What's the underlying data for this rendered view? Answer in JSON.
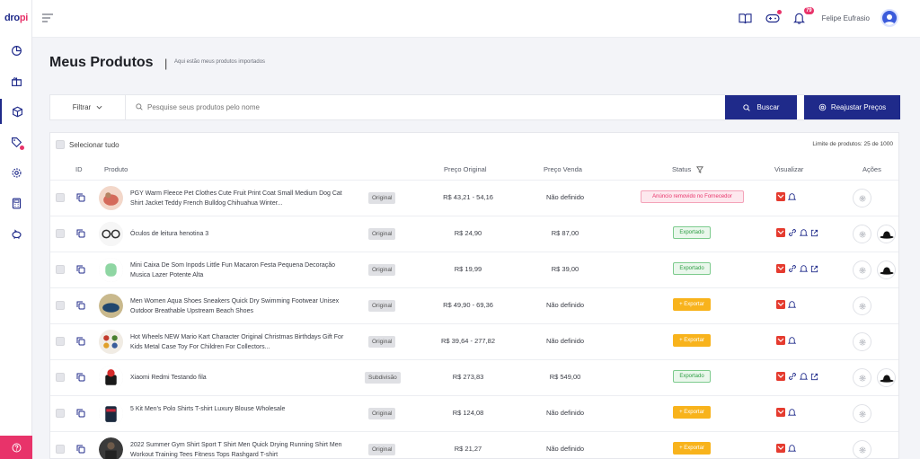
{
  "app": {
    "logo": "dropi"
  },
  "topbar": {
    "user_name": "Felipe Eufrasio",
    "notification_count": "79"
  },
  "header": {
    "title": "Meus Produtos",
    "subtitle": "Aqui estão meus produtos importados"
  },
  "search": {
    "filter_label": "Filtrar",
    "placeholder": "Pesquise seus produtos pelo nome",
    "buscar_label": "Buscar",
    "reajustar_label": "Reajustar Preços"
  },
  "table": {
    "select_all": "Selecionar tudo",
    "limit": "Limite de produtos: 25 de 1000",
    "headers": {
      "id": "ID",
      "produto": "Produto",
      "preco_original": "Preço Original",
      "preco_venda": "Preço Venda",
      "status": "Status",
      "visualizar": "Visualizar",
      "acoes": "Ações"
    },
    "rows": [
      {
        "name": "PGY Warm Fleece Pet Clothes Cute Fruit Print Coat Small Medium Dog Cat Shirt Jacket Teddy French Bulldog Chihuahua Winter...",
        "type": "Original",
        "price_orig": "R$ 43,21 - 54,16",
        "price_sale": "Não definido",
        "status": "Anúncio removido no Fornecedor",
        "status_kind": "removed"
      },
      {
        "name": "Óculos de leitura henotina 3",
        "type": "Original",
        "price_orig": "R$ 24,90",
        "price_sale": "R$ 87,00",
        "status": "Exportado",
        "status_kind": "exported"
      },
      {
        "name": "Mini Caixa De Som Inpods Little Fun Macaron Festa Pequena Decoração Musica Lazer Potente Alta",
        "type": "Original",
        "price_orig": "R$ 19,99",
        "price_sale": "R$ 39,00",
        "status": "Exportado",
        "status_kind": "exported"
      },
      {
        "name": "Men Women Aqua Shoes Sneakers Quick Dry Swimming Footwear Unisex Outdoor Breathable Upstream Beach Shoes",
        "type": "Original",
        "price_orig": "R$ 49,90 - 69,36",
        "price_sale": "Não definido",
        "status": "+ Exportar",
        "status_kind": "export"
      },
      {
        "name": "Hot Wheels NEW Mario Kart Character Original Christmas Birthdays Gift For Kids Metal Case Toy For Children For Collectors...",
        "type": "Original",
        "price_orig": "R$ 39,64 - 277,82",
        "price_sale": "Não definido",
        "status": "+ Exportar",
        "status_kind": "export"
      },
      {
        "name": "Xiaomi Redmi Testando fila",
        "type": "Subdivisão",
        "price_orig": "R$ 273,83",
        "price_sale": "R$ 549,00",
        "status": "Exportado",
        "status_kind": "exported"
      },
      {
        "name": "5 Kit Men's Polo Shirts T-shirt Luxury Blouse Wholesale",
        "type": "Original",
        "price_orig": "R$ 124,08",
        "price_sale": "Não definido",
        "status": "+ Exportar",
        "status_kind": "export"
      },
      {
        "name": "2022 Summer Gym Shirt Sport T Shirt Men Quick Drying Running Shirt Men Workout Training Tees Fitness Tops Rashgard T-shirt",
        "type": "Original",
        "price_orig": "R$ 21,27",
        "price_sale": "Não definido",
        "status": "+ Exportar",
        "status_kind": "export"
      }
    ]
  },
  "colors": {
    "primary": "#1f2a8a",
    "accent": "#e8336a",
    "export": "#f8b31c",
    "exported": "#2e9e45"
  }
}
